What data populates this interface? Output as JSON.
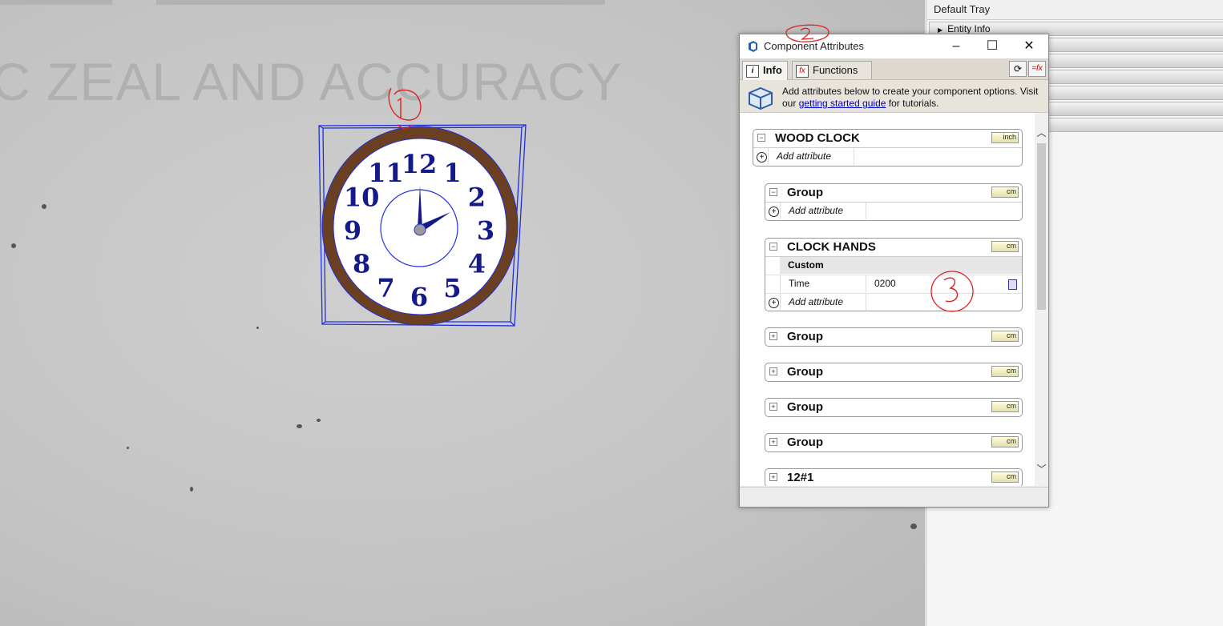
{
  "viewport": {
    "background_text": "C ZEAL AND ACCURACY",
    "clock_numerals": [
      "12",
      "1",
      "2",
      "3",
      "4",
      "5",
      "6",
      "7",
      "8",
      "9",
      "10",
      "11"
    ],
    "annotation_1": "1"
  },
  "tray": {
    "title": "Default Tray",
    "first_panel": "Entity Info"
  },
  "dialog": {
    "title": "Component Attributes",
    "title_annotation": "2",
    "minimize": "–",
    "maximize": "☐",
    "close": "✕",
    "tabs": [
      {
        "label": "Info",
        "icon": "info-icon"
      },
      {
        "label": "Functions",
        "icon": "function-icon"
      }
    ],
    "info": {
      "text_before": "Add attributes below to create your component options. Visit our ",
      "link": "getting started guide",
      "text_after": " for tutorials."
    },
    "components": [
      {
        "name": "WOOD CLOCK",
        "unit": "inch",
        "add": "Add attribute"
      },
      {
        "name": "Group",
        "unit": "cm",
        "add": "Add attribute"
      },
      {
        "name": "CLOCK HANDS",
        "unit": "cm",
        "section": "Custom",
        "attribute": {
          "label": "Time",
          "value": "0200"
        },
        "add": "Add attribute",
        "annotation": "3"
      },
      {
        "name": "Group",
        "unit": "cm"
      },
      {
        "name": "Group",
        "unit": "cm"
      },
      {
        "name": "Group",
        "unit": "cm"
      },
      {
        "name": "Group",
        "unit": "cm"
      },
      {
        "name": "12#1",
        "unit": "cm"
      }
    ]
  },
  "colors": {
    "selection": "#1f2fe0",
    "numerals": "#141a8a",
    "rim": "#6b3f22",
    "annotation": "#e02020"
  }
}
